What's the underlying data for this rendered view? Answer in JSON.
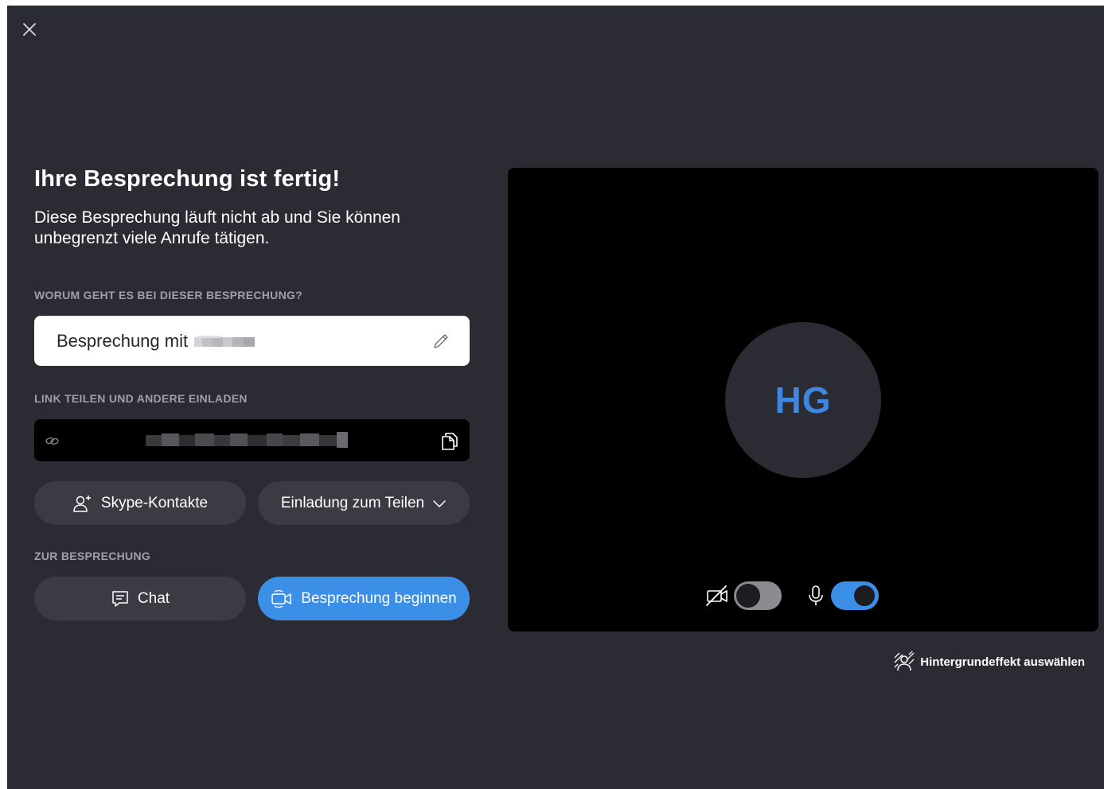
{
  "window": {
    "close_label": "",
    "title": "Ihre Besprechung ist fertig!",
    "subtitle": "Diese Besprechung läuft nicht ab und Sie können unbegrenzt viele Anrufe tätigen."
  },
  "topic": {
    "label": "WORUM GEHT ES BEI DIESER BESPRECHUNG?",
    "value_prefix": "Besprechung mit"
  },
  "share": {
    "label": "LINK TEILEN UND ANDERE EINLADEN",
    "skype_contacts_label": "Skype-Kontakte",
    "invite_label": "Einladung zum Teilen"
  },
  "join": {
    "label": "ZUR BESPRECHUNG",
    "chat_label": "Chat",
    "start_label": "Besprechung beginnen"
  },
  "preview": {
    "initials": "HG",
    "camera_on": false,
    "mic_on": true,
    "background_effect_label": "Hintergrundeffekt auswählen"
  },
  "colors": {
    "background": "#2b2c33",
    "accent": "#3b8fe6",
    "initials": "#3f86e0"
  }
}
